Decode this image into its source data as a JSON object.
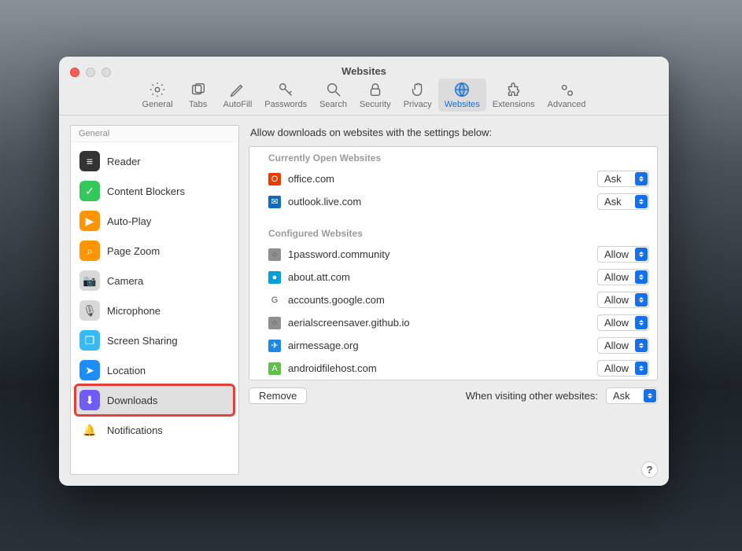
{
  "window": {
    "title": "Websites"
  },
  "toolbar": {
    "general": "General",
    "tabs": "Tabs",
    "autofill": "AutoFill",
    "passwords": "Passwords",
    "search": "Search",
    "security": "Security",
    "privacy": "Privacy",
    "websites": "Websites",
    "extensions": "Extensions",
    "advanced": "Advanced"
  },
  "sidebar": {
    "header": "General",
    "items": [
      {
        "label": "Reader",
        "icon_bg": "#333333",
        "icon_glyph": "≡"
      },
      {
        "label": "Content Blockers",
        "icon_bg": "#34c759",
        "icon_glyph": "✓"
      },
      {
        "label": "Auto-Play",
        "icon_bg": "#ff9500",
        "icon_glyph": "▶"
      },
      {
        "label": "Page Zoom",
        "icon_bg": "#ff9500",
        "icon_glyph": "⌕"
      },
      {
        "label": "Camera",
        "icon_bg": "#d9d9d9",
        "icon_glyph": "📷"
      },
      {
        "label": "Microphone",
        "icon_bg": "#d9d9d9",
        "icon_glyph": "🎙"
      },
      {
        "label": "Screen Sharing",
        "icon_bg": "#36b9f4",
        "icon_glyph": "❐"
      },
      {
        "label": "Location",
        "icon_bg": "#1d8ef7",
        "icon_glyph": "➤"
      },
      {
        "label": "Downloads",
        "icon_bg": "#6f5cf7",
        "icon_glyph": "⬇"
      },
      {
        "label": "Notifications",
        "icon_bg": "#ffffff",
        "icon_glyph": "🔔"
      }
    ],
    "selected_index": 8
  },
  "main": {
    "heading": "Allow downloads on websites with the settings below:",
    "open_section": "Currently Open Websites",
    "configured_section": "Configured Websites",
    "open_sites": [
      {
        "name": "office.com",
        "favicon_bg": "#eb3c00",
        "favicon_glyph": "O",
        "value": "Ask"
      },
      {
        "name": "outlook.live.com",
        "favicon_bg": "#0f6cbd",
        "favicon_glyph": "✉",
        "value": "Ask"
      }
    ],
    "configured_sites": [
      {
        "name": "1password.community",
        "favicon_bg": "#8f8f8f",
        "favicon_glyph": "○",
        "value": "Allow"
      },
      {
        "name": "about.att.com",
        "favicon_bg": "#009fdb",
        "favicon_glyph": "●",
        "value": "Allow"
      },
      {
        "name": "accounts.google.com",
        "favicon_bg": "#ffffff",
        "favicon_glyph": "G",
        "value": "Allow"
      },
      {
        "name": "aerialscreensaver.github.io",
        "favicon_bg": "#8f8f8f",
        "favicon_glyph": "○",
        "value": "Allow"
      },
      {
        "name": "airmessage.org",
        "favicon_bg": "#1e88e5",
        "favicon_glyph": "✈",
        "value": "Allow"
      },
      {
        "name": "androidfilehost.com",
        "favicon_bg": "#5fbf4b",
        "favicon_glyph": "A",
        "value": "Allow"
      }
    ],
    "remove_button": "Remove",
    "other_label": "When visiting other websites:",
    "other_value": "Ask"
  },
  "help": {
    "glyph": "?"
  }
}
